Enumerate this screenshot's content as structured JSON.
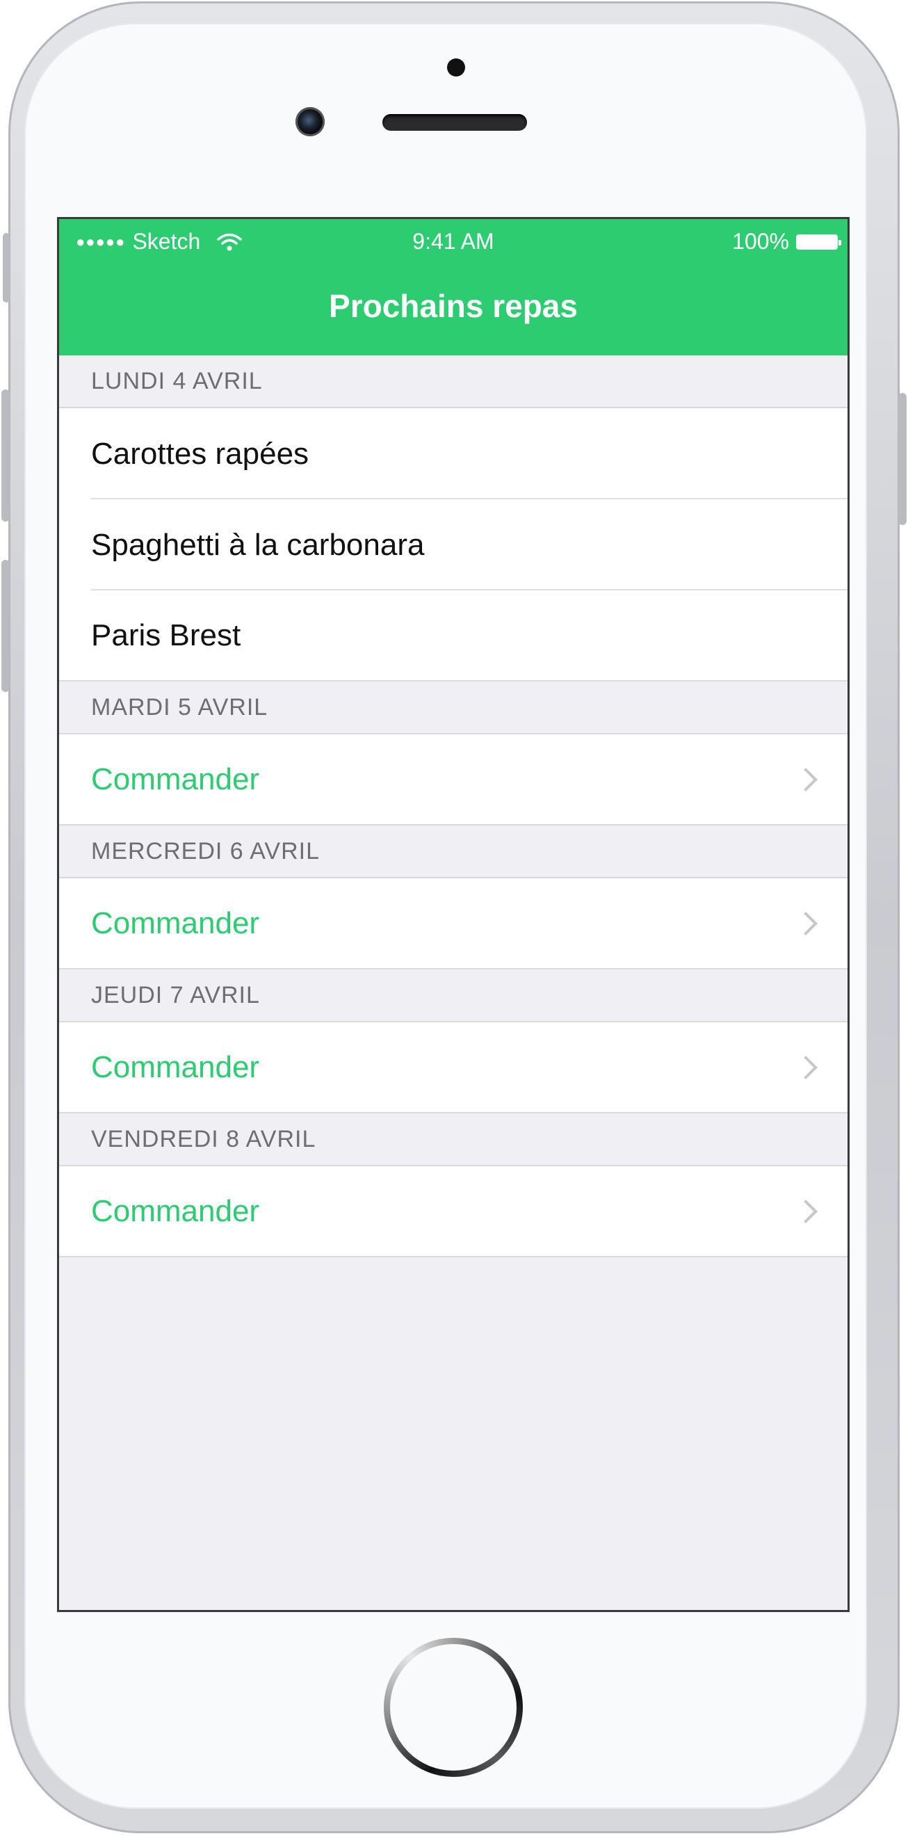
{
  "status_bar": {
    "signal": "●●●●●",
    "carrier": "Sketch",
    "wifi_icon": "wifi-icon",
    "time": "9:41 AM",
    "battery": "100%",
    "battery_icon": "battery-icon"
  },
  "nav": {
    "title": "Prochains repas",
    "color": "#2ecc71"
  },
  "sections": [
    {
      "header": "LUNDI 4 AVRIL",
      "items": [
        "Carottes rapées",
        "Spaghetti à la carbonara",
        "Paris Brest"
      ]
    },
    {
      "header": "MARDI 5 AVRIL",
      "action": "Commander"
    },
    {
      "header": "MERCREDI 6 AVRIL",
      "action": "Commander"
    },
    {
      "header": "JEUDI 7 AVRIL",
      "action": "Commander"
    },
    {
      "header": "VENDREDI 8 AVRIL",
      "action": "Commander"
    }
  ],
  "icons": {
    "row_disclosure": "chevron-right-icon"
  }
}
